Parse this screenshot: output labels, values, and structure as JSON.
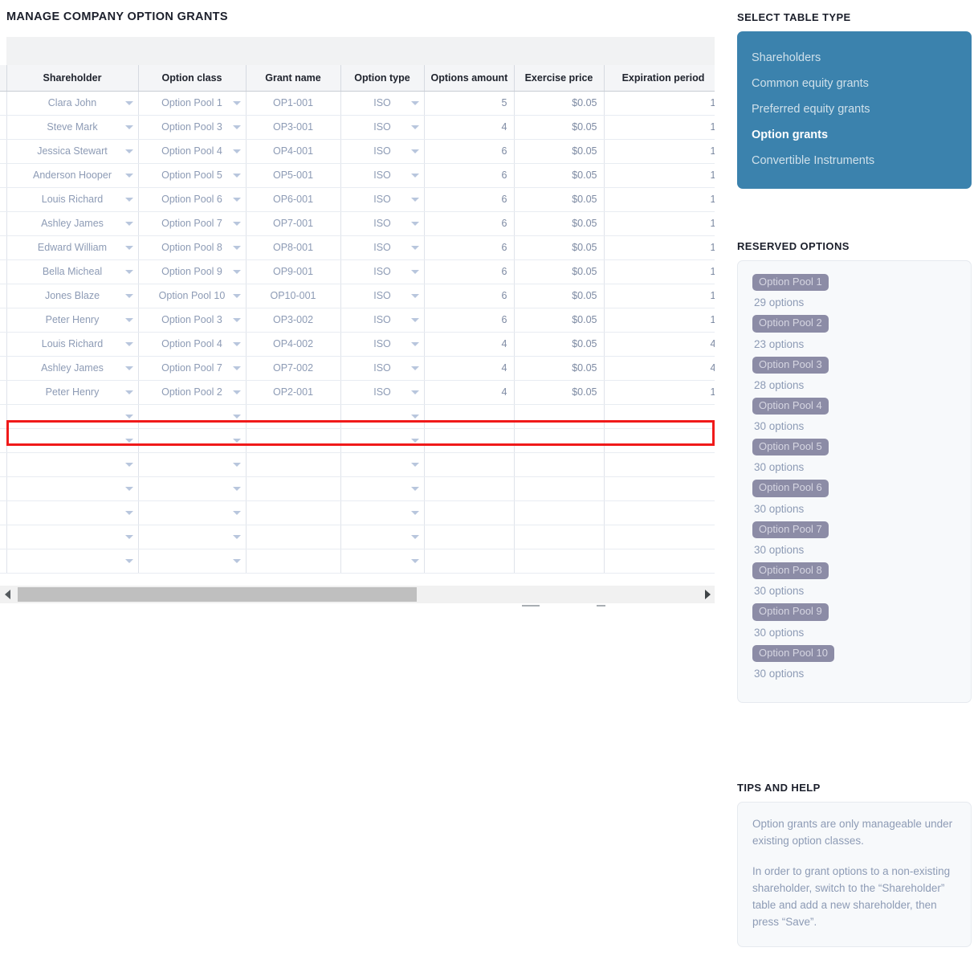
{
  "page_title": "MANAGE COMPANY OPTION GRANTS",
  "table": {
    "columns": [
      "Shareholder",
      "Option class",
      "Grant name",
      "Option type",
      "Options amount",
      "Exercise price",
      "Expiration period"
    ],
    "rows": [
      {
        "shareholder": "Clara John",
        "option_class": "Option Pool 1",
        "grant_name": "OP1-001",
        "option_type": "ISO",
        "options_amount": "5",
        "exercise_price": "$0.05",
        "expiration_period": "1"
      },
      {
        "shareholder": "Steve Mark",
        "option_class": "Option Pool 3",
        "grant_name": "OP3-001",
        "option_type": "ISO",
        "options_amount": "4",
        "exercise_price": "$0.05",
        "expiration_period": "1"
      },
      {
        "shareholder": "Jessica Stewart",
        "option_class": "Option Pool 4",
        "grant_name": "OP4-001",
        "option_type": "ISO",
        "options_amount": "6",
        "exercise_price": "$0.05",
        "expiration_period": "1"
      },
      {
        "shareholder": "Anderson Hooper",
        "option_class": "Option Pool 5",
        "grant_name": "OP5-001",
        "option_type": "ISO",
        "options_amount": "6",
        "exercise_price": "$0.05",
        "expiration_period": "1"
      },
      {
        "shareholder": "Louis Richard",
        "option_class": "Option Pool 6",
        "grant_name": "OP6-001",
        "option_type": "ISO",
        "options_amount": "6",
        "exercise_price": "$0.05",
        "expiration_period": "1"
      },
      {
        "shareholder": "Ashley James",
        "option_class": "Option Pool 7",
        "grant_name": "OP7-001",
        "option_type": "ISO",
        "options_amount": "6",
        "exercise_price": "$0.05",
        "expiration_period": "1"
      },
      {
        "shareholder": "Edward William",
        "option_class": "Option Pool 8",
        "grant_name": "OP8-001",
        "option_type": "ISO",
        "options_amount": "6",
        "exercise_price": "$0.05",
        "expiration_period": "1"
      },
      {
        "shareholder": "Bella Micheal",
        "option_class": "Option Pool 9",
        "grant_name": "OP9-001",
        "option_type": "ISO",
        "options_amount": "6",
        "exercise_price": "$0.05",
        "expiration_period": "1"
      },
      {
        "shareholder": "Jones Blaze",
        "option_class": "Option Pool 10",
        "grant_name": "OP10-001",
        "option_type": "ISO",
        "options_amount": "6",
        "exercise_price": "$0.05",
        "expiration_period": "1"
      },
      {
        "shareholder": "Peter Henry",
        "option_class": "Option Pool 3",
        "grant_name": "OP3-002",
        "option_type": "ISO",
        "options_amount": "6",
        "exercise_price": "$0.05",
        "expiration_period": "1"
      },
      {
        "shareholder": "Louis Richard",
        "option_class": "Option Pool 4",
        "grant_name": "OP4-002",
        "option_type": "ISO",
        "options_amount": "4",
        "exercise_price": "$0.05",
        "expiration_period": "4"
      },
      {
        "shareholder": "Ashley James",
        "option_class": "Option Pool 7",
        "grant_name": "OP7-002",
        "option_type": "ISO",
        "options_amount": "4",
        "exercise_price": "$0.05",
        "expiration_period": "4"
      },
      {
        "shareholder": "Peter Henry",
        "option_class": "Option Pool 2",
        "grant_name": "OP2-001",
        "option_type": "ISO",
        "options_amount": "4",
        "exercise_price": "$0.05",
        "expiration_period": "1",
        "highlighted": true
      }
    ],
    "empty_row_count": 7,
    "highlight_color": "#f01a1a"
  },
  "scrollbar": {
    "left_arrow": "scroll-left-arrow",
    "right_arrow": "scroll-right-arrow"
  },
  "select_table_type": {
    "heading": "SELECT TABLE TYPE",
    "accent_color": "#3b82ad",
    "items": [
      {
        "label": "Shareholders",
        "active": false
      },
      {
        "label": "Common equity grants",
        "active": false
      },
      {
        "label": "Preferred equity grants",
        "active": false
      },
      {
        "label": "Option grants",
        "active": true
      },
      {
        "label": "Convertible Instruments",
        "active": false
      }
    ]
  },
  "reserved_options": {
    "heading": "RESERVED OPTIONS",
    "badge_color": "#8c8ca6",
    "pools": [
      {
        "name": "Option Pool 1",
        "count": "29 options"
      },
      {
        "name": "Option Pool 2",
        "count": "23 options"
      },
      {
        "name": "Option Pool 3",
        "count": "28 options"
      },
      {
        "name": "Option Pool 4",
        "count": "30 options"
      },
      {
        "name": "Option Pool 5",
        "count": "30 options"
      },
      {
        "name": "Option Pool 6",
        "count": "30 options"
      },
      {
        "name": "Option Pool 7",
        "count": "30 options"
      },
      {
        "name": "Option Pool 8",
        "count": "30 options"
      },
      {
        "name": "Option Pool 9",
        "count": "30 options"
      },
      {
        "name": "Option Pool 10",
        "count": "30 options"
      }
    ]
  },
  "tips_and_help": {
    "heading": "TIPS AND HELP",
    "paragraphs": [
      "Option grants are only manageable under existing option classes.",
      "In order to grant options to a non-existing shareholder, switch to the “Shareholder” table and add a new shareholder, then press “Save”."
    ]
  }
}
